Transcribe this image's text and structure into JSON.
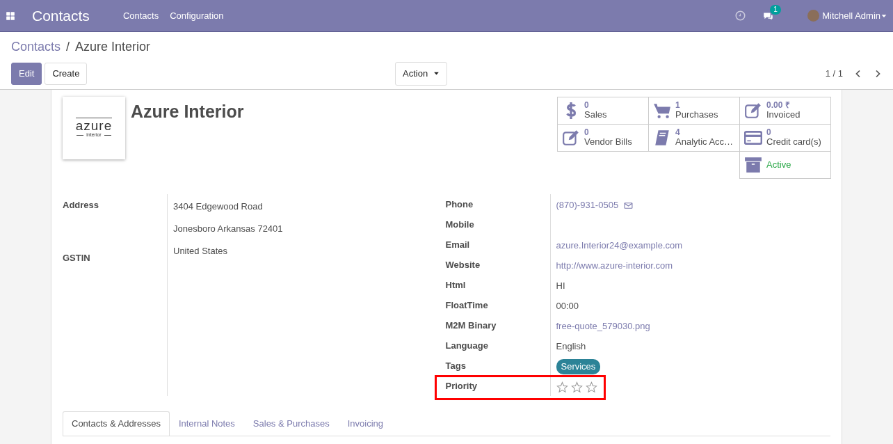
{
  "navbar": {
    "app_name": "Contacts",
    "menu": [
      "Contacts",
      "Configuration"
    ],
    "messages_count": "1",
    "user": "Mitchell Admin"
  },
  "breadcrumb": {
    "parent": "Contacts",
    "separator": "/",
    "current": "Azure Interior"
  },
  "buttons": {
    "edit": "Edit",
    "create": "Create",
    "action": "Action"
  },
  "pager": {
    "text": "1 / 1"
  },
  "record": {
    "logo": {
      "word": "azure",
      "subword": "interior"
    },
    "name": "Azure Interior"
  },
  "stat_buttons": [
    {
      "kind": "stat",
      "value": "0",
      "label": "Sales"
    },
    {
      "kind": "stat",
      "value": "1",
      "label": "Purchases"
    },
    {
      "kind": "stat",
      "value": "0.00 ₹",
      "label": "Invoiced"
    },
    {
      "kind": "stat",
      "value": "0",
      "label": "Vendor Bills"
    },
    {
      "kind": "stat",
      "value": "4",
      "label": "Analytic Acc…"
    },
    {
      "kind": "stat",
      "value": "0",
      "label": "Credit card(s)"
    },
    {
      "kind": "toggle",
      "label": "Active"
    }
  ],
  "left_fields": [
    {
      "label": "Address",
      "lines": [
        "3404 Edgewood Road",
        "Jonesboro  Arkansas  72401",
        "United States"
      ]
    },
    {
      "label": "GSTIN"
    }
  ],
  "right_fields": [
    {
      "label": "Phone",
      "kind": "phone",
      "value": "(870)-931-0505"
    },
    {
      "label": "Mobile",
      "kind": "text"
    },
    {
      "label": "Email",
      "kind": "link",
      "value": "azure.Interior24@example.com"
    },
    {
      "label": "Website",
      "kind": "link",
      "value": "http://www.azure-interior.com"
    },
    {
      "label": "Html",
      "kind": "text",
      "value": "HI"
    },
    {
      "label": "FloatTime",
      "kind": "text",
      "value": "00:00"
    },
    {
      "label": "M2M Binary",
      "kind": "link",
      "value": "free-quote_579030.png"
    },
    {
      "label": "Language",
      "kind": "text",
      "value": "English"
    },
    {
      "label": "Tags",
      "kind": "tag",
      "value": "Services"
    },
    {
      "label": "Priority",
      "kind": "stars",
      "stars": 0,
      "highlighted": true
    }
  ],
  "tabs": [
    {
      "label": "Contacts & Addresses",
      "selected": true
    },
    {
      "label": "Internal Notes",
      "selected": false
    },
    {
      "label": "Sales & Purchases",
      "selected": false
    },
    {
      "label": "Invoicing",
      "selected": false
    }
  ]
}
